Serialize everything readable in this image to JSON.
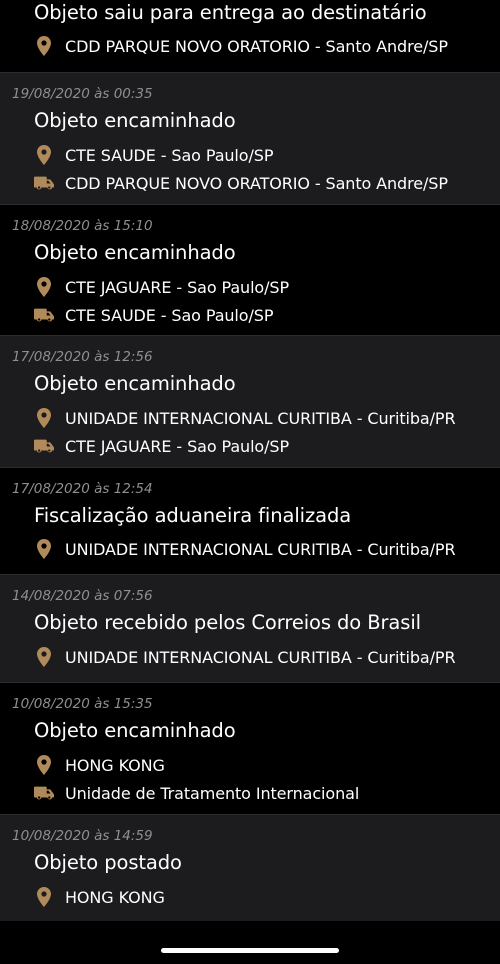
{
  "accent_color": "#b08a5a",
  "events": [
    {
      "date": "",
      "title": "Objeto saiu para entrega ao destinatário",
      "location": "CDD PARQUE NOVO ORATORIO - Santo Andre/SP",
      "destination": null
    },
    {
      "date": "19/08/2020 às 00:35",
      "title": "Objeto encaminhado",
      "location": "CTE SAUDE - Sao Paulo/SP",
      "destination": "CDD PARQUE NOVO ORATORIO - Santo Andre/SP"
    },
    {
      "date": "18/08/2020 às 15:10",
      "title": "Objeto encaminhado",
      "location": "CTE JAGUARE - Sao Paulo/SP",
      "destination": "CTE SAUDE - Sao Paulo/SP"
    },
    {
      "date": "17/08/2020 às 12:56",
      "title": "Objeto encaminhado",
      "location": "UNIDADE INTERNACIONAL CURITIBA - Curitiba/PR",
      "destination": "CTE JAGUARE - Sao Paulo/SP"
    },
    {
      "date": "17/08/2020 às 12:54",
      "title": "Fiscalização aduaneira finalizada",
      "location": "UNIDADE INTERNACIONAL CURITIBA - Curitiba/PR",
      "destination": null
    },
    {
      "date": "14/08/2020 às 07:56",
      "title": "Objeto recebido pelos Correios do Brasil",
      "location": "UNIDADE INTERNACIONAL CURITIBA - Curitiba/PR",
      "destination": null
    },
    {
      "date": "10/08/2020 às 15:35",
      "title": "Objeto encaminhado",
      "location": "HONG KONG",
      "destination": "Unidade de Tratamento Internacional"
    },
    {
      "date": "10/08/2020 às 14:59",
      "title": "Objeto postado",
      "location": "HONG KONG",
      "destination": null
    }
  ],
  "icons": {
    "location": "map-pin-icon",
    "destination": "delivery-truck-icon"
  }
}
